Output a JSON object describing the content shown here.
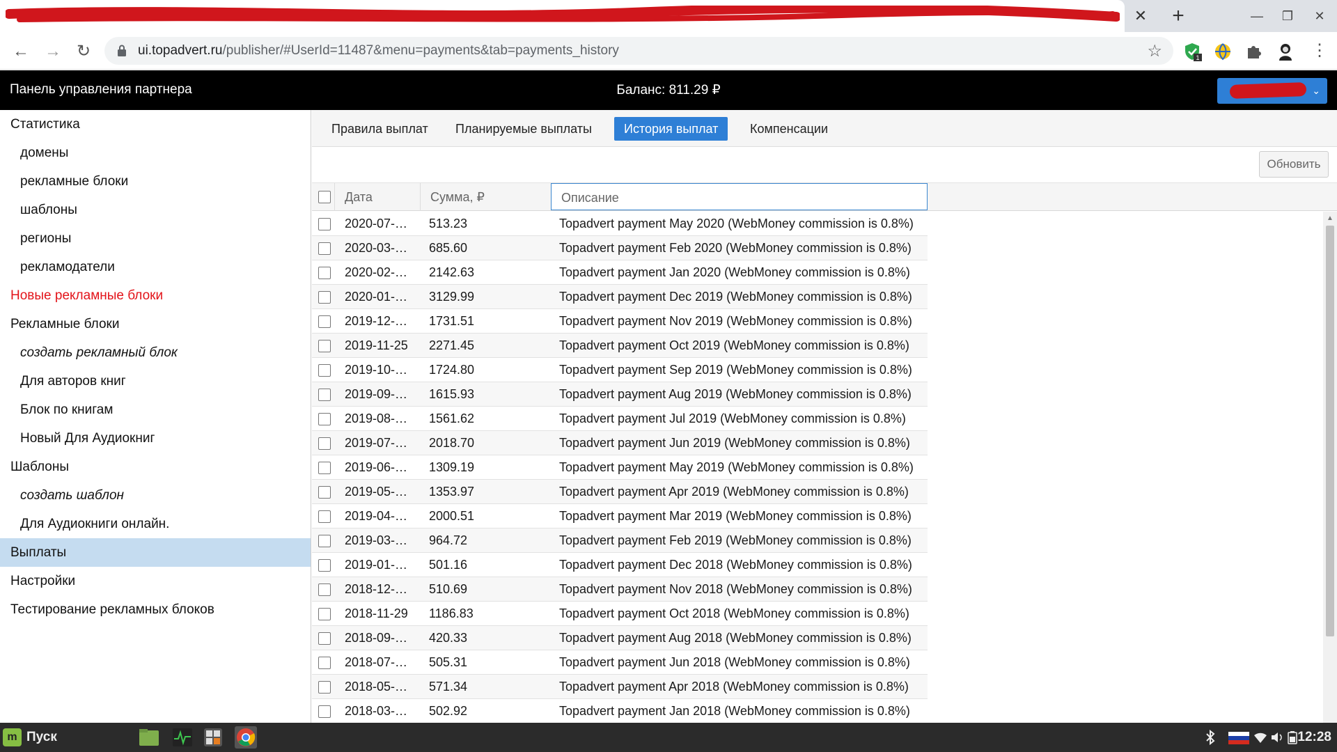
{
  "browser": {
    "url_host": "ui.topadvert.ru",
    "url_path": "/publisher/#UserId=11487&menu=payments&tab=payments_history",
    "new_tab": "+",
    "close_tab": "✕",
    "minimize": "—",
    "maximize": "❐",
    "close_window": "✕",
    "back": "←",
    "forward": "→",
    "reload": "↻",
    "bookmark_star": "☆",
    "menu": "⋮",
    "extension_badge": "1"
  },
  "header": {
    "title": "Панель управления партнера",
    "balance": "Баланс: 811.29 ₽",
    "user_button_chevron": "⌄"
  },
  "sidebar": {
    "items": [
      {
        "label": "Статистика",
        "style": "top"
      },
      {
        "label": "домены",
        "style": "sub"
      },
      {
        "label": "рекламные блоки",
        "style": "sub"
      },
      {
        "label": "шаблоны",
        "style": "sub"
      },
      {
        "label": "регионы",
        "style": "sub"
      },
      {
        "label": "рекламодатели",
        "style": "sub"
      },
      {
        "label": "Новые рекламные блоки",
        "style": "red"
      },
      {
        "label": "Рекламные блоки",
        "style": "top"
      },
      {
        "label": "создать рекламный блок",
        "style": "sub italic"
      },
      {
        "label": "Для авторов книг",
        "style": "sub"
      },
      {
        "label": "Блок по книгам",
        "style": "sub"
      },
      {
        "label": "Новый Для Аудиокниг",
        "style": "sub"
      },
      {
        "label": "Шаблоны",
        "style": "top"
      },
      {
        "label": "создать шаблон",
        "style": "sub italic"
      },
      {
        "label": "Для Аудиокниги онлайн.",
        "style": "sub"
      },
      {
        "label": "Выплаты",
        "style": "selected"
      },
      {
        "label": "Настройки",
        "style": "top"
      },
      {
        "label": "Тестирование рекламных блоков",
        "style": "top"
      }
    ]
  },
  "tabs": [
    {
      "label": "Правила выплат",
      "active": false
    },
    {
      "label": "Планируемые выплаты",
      "active": false
    },
    {
      "label": "История выплат",
      "active": true
    },
    {
      "label": "Компенсации",
      "active": false
    }
  ],
  "toolbar": {
    "refresh_label": "Обновить"
  },
  "grid": {
    "columns": {
      "date": "Дата",
      "sum": "Сумма, ₽",
      "desc": "Описание"
    },
    "rows": [
      {
        "date": "2020-07-…",
        "sum": "513.23",
        "desc": "Topadvert payment May 2020 (WebMoney commission is 0.8%)"
      },
      {
        "date": "2020-03-…",
        "sum": "685.60",
        "desc": "Topadvert payment Feb 2020 (WebMoney commission is 0.8%)"
      },
      {
        "date": "2020-02-…",
        "sum": "2142.63",
        "desc": "Topadvert payment Jan 2020 (WebMoney commission is 0.8%)"
      },
      {
        "date": "2020-01-…",
        "sum": "3129.99",
        "desc": "Topadvert payment Dec 2019 (WebMoney commission is 0.8%)"
      },
      {
        "date": "2019-12-…",
        "sum": "1731.51",
        "desc": "Topadvert payment Nov 2019 (WebMoney commission is 0.8%)"
      },
      {
        "date": "2019-11-25",
        "sum": "2271.45",
        "desc": "Topadvert payment Oct 2019 (WebMoney commission is 0.8%)"
      },
      {
        "date": "2019-10-…",
        "sum": "1724.80",
        "desc": "Topadvert payment Sep 2019 (WebMoney commission is 0.8%)"
      },
      {
        "date": "2019-09-…",
        "sum": "1615.93",
        "desc": "Topadvert payment Aug 2019 (WebMoney commission is 0.8%)"
      },
      {
        "date": "2019-08-…",
        "sum": "1561.62",
        "desc": "Topadvert payment Jul 2019 (WebMoney commission is 0.8%)"
      },
      {
        "date": "2019-07-…",
        "sum": "2018.70",
        "desc": "Topadvert payment Jun 2019 (WebMoney commission is 0.8%)"
      },
      {
        "date": "2019-06-…",
        "sum": "1309.19",
        "desc": "Topadvert payment May 2019 (WebMoney commission is 0.8%)"
      },
      {
        "date": "2019-05-…",
        "sum": "1353.97",
        "desc": "Topadvert payment Apr 2019 (WebMoney commission is 0.8%)"
      },
      {
        "date": "2019-04-…",
        "sum": "2000.51",
        "desc": "Topadvert payment Mar 2019 (WebMoney commission is 0.8%)"
      },
      {
        "date": "2019-03-…",
        "sum": "964.72",
        "desc": "Topadvert payment Feb 2019 (WebMoney commission is 0.8%)"
      },
      {
        "date": "2019-01-…",
        "sum": "501.16",
        "desc": "Topadvert payment Dec 2018 (WebMoney commission is 0.8%)"
      },
      {
        "date": "2018-12-…",
        "sum": "510.69",
        "desc": "Topadvert payment Nov 2018 (WebMoney commission is 0.8%)"
      },
      {
        "date": "2018-11-29",
        "sum": "1186.83",
        "desc": "Topadvert payment Oct 2018 (WebMoney commission is 0.8%)"
      },
      {
        "date": "2018-09-…",
        "sum": "420.33",
        "desc": "Topadvert payment Aug 2018 (WebMoney commission is 0.8%)"
      },
      {
        "date": "2018-07-…",
        "sum": "505.31",
        "desc": "Topadvert payment Jun 2018 (WebMoney commission is 0.8%)"
      },
      {
        "date": "2018-05-…",
        "sum": "571.34",
        "desc": "Topadvert payment Apr 2018 (WebMoney commission is 0.8%)"
      },
      {
        "date": "2018-03-…",
        "sum": "502.92",
        "desc": "Topadvert payment Jan 2018 (WebMoney commission is 0.8%)"
      }
    ]
  },
  "taskbar": {
    "start_label": "Пуск",
    "start_logo": "m",
    "clock": "12:28"
  },
  "colors": {
    "accent": "#2e7fd6",
    "selected_row": "#c5dcf0",
    "alert_text": "#e3141a",
    "header_bg": "#000000"
  }
}
